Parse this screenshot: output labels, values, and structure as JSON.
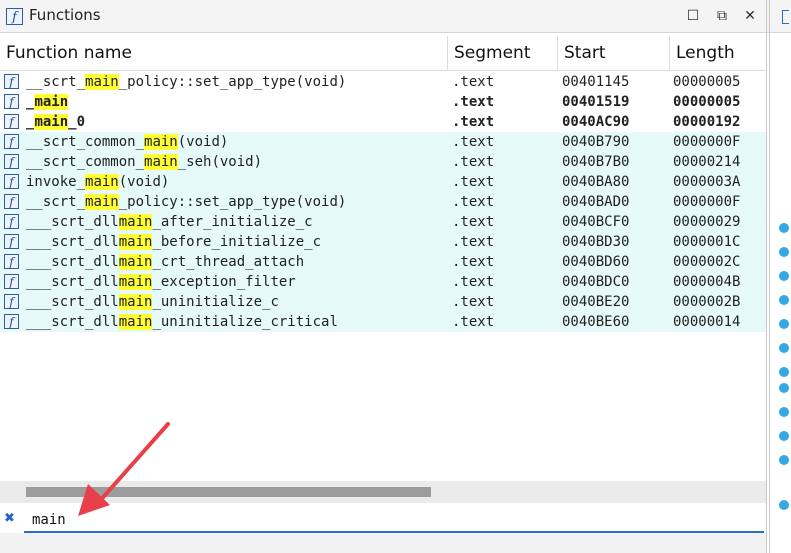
{
  "window": {
    "title": "Functions",
    "icon": "f",
    "controls": {
      "maximize": "maximize-icon",
      "restore": "restore-icon",
      "close": "close-icon"
    }
  },
  "columns": [
    "Function name",
    "Segment",
    "Start",
    "Length"
  ],
  "rows": [
    {
      "name_parts": [
        "__scrt_",
        "main",
        "_policy::set_app_type(void)"
      ],
      "segment": ".text",
      "start": "00401145",
      "length": "00000005",
      "bold": false,
      "highlight": false
    },
    {
      "name_parts": [
        "_",
        "main",
        ""
      ],
      "segment": ".text",
      "start": "00401519",
      "length": "00000005",
      "bold": true,
      "highlight": false
    },
    {
      "name_parts": [
        "_",
        "main",
        "_0"
      ],
      "segment": ".text",
      "start": "0040AC90",
      "length": "00000192",
      "bold": true,
      "highlight": false
    },
    {
      "name_parts": [
        "__scrt_common_",
        "main",
        "(void)"
      ],
      "segment": ".text",
      "start": "0040B790",
      "length": "0000000F",
      "bold": false,
      "highlight": true
    },
    {
      "name_parts": [
        "__scrt_common_",
        "main",
        "_seh(void)"
      ],
      "segment": ".text",
      "start": "0040B7B0",
      "length": "00000214",
      "bold": false,
      "highlight": true
    },
    {
      "name_parts": [
        "invoke_",
        "main",
        "(void)"
      ],
      "segment": ".text",
      "start": "0040BA80",
      "length": "0000003A",
      "bold": false,
      "highlight": true
    },
    {
      "name_parts": [
        "__scrt_",
        "main",
        "_policy::set_app_type(void)"
      ],
      "segment": ".text",
      "start": "0040BAD0",
      "length": "0000000F",
      "bold": false,
      "highlight": true
    },
    {
      "name_parts": [
        "___scrt_dll",
        "main",
        "_after_initialize_c"
      ],
      "segment": ".text",
      "start": "0040BCF0",
      "length": "00000029",
      "bold": false,
      "highlight": true
    },
    {
      "name_parts": [
        "___scrt_dll",
        "main",
        "_before_initialize_c"
      ],
      "segment": ".text",
      "start": "0040BD30",
      "length": "0000001C",
      "bold": false,
      "highlight": true
    },
    {
      "name_parts": [
        "___scrt_dll",
        "main",
        "_crt_thread_attach"
      ],
      "segment": ".text",
      "start": "0040BD60",
      "length": "0000002C",
      "bold": false,
      "highlight": true
    },
    {
      "name_parts": [
        "___scrt_dll",
        "main",
        "_exception_filter"
      ],
      "segment": ".text",
      "start": "0040BDC0",
      "length": "0000004B",
      "bold": false,
      "highlight": true
    },
    {
      "name_parts": [
        "___scrt_dll",
        "main",
        "_uninitialize_c"
      ],
      "segment": ".text",
      "start": "0040BE20",
      "length": "0000002B",
      "bold": false,
      "highlight": true
    },
    {
      "name_parts": [
        "___scrt_dll",
        "main",
        "_uninitialize_critical"
      ],
      "segment": ".text",
      "start": "0040BE60",
      "length": "00000014",
      "bold": false,
      "highlight": true
    }
  ],
  "filter": {
    "value": "main",
    "close_icon": "close-filter-icon"
  },
  "colors": {
    "match_highlight": "#ffff33",
    "row_highlight": "#e6fafa",
    "accent": "#2a70c8",
    "arrow": "#e8404a"
  }
}
